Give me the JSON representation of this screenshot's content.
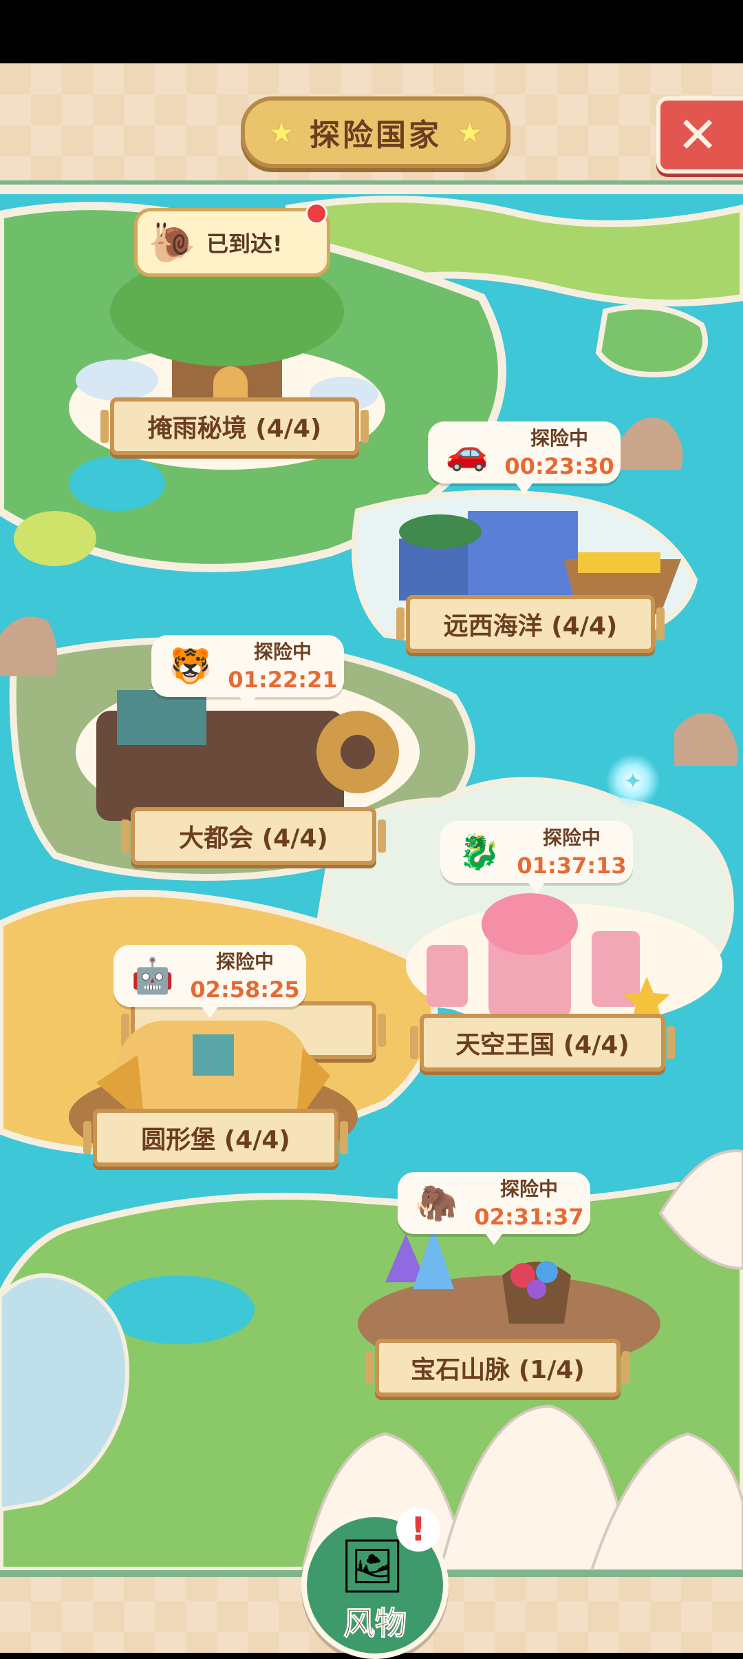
{
  "header": {
    "title": "探险国家"
  },
  "locations": [
    {
      "name": "掩雨秘境 (4/4)",
      "status": "已到达!",
      "avatar_icon": "snail-icon"
    },
    {
      "name": "远西海洋 (4/4)",
      "status": "探险中",
      "timer": "00:23:30",
      "avatar_icon": "car-icon"
    },
    {
      "name": "大都会 (4/4)",
      "status": "探险中",
      "timer": "01:22:21",
      "avatar_icon": "tiger-icon"
    },
    {
      "name": "天空王国 (4/4)",
      "status": "探险中",
      "timer": "01:37:13",
      "avatar_icon": "dragon-icon"
    },
    {
      "name": "圆形堡 (4/4)",
      "status": "探险中",
      "timer": "02:58:25",
      "avatar_icon": "robot-cat-icon"
    },
    {
      "name": "宝石山脉 (1/4)",
      "status": "探险中",
      "timer": "02:31:37",
      "avatar_icon": "mammoth-icon"
    }
  ],
  "footer": {
    "souvenir_label": "风物",
    "alert": "!"
  },
  "colors": {
    "ocean": "#3ec7d6",
    "grass": "#7cc46b",
    "sand": "#f3c766",
    "banner": "#f6e3b9",
    "timer": "#e56a34",
    "close": "#e3564f"
  }
}
